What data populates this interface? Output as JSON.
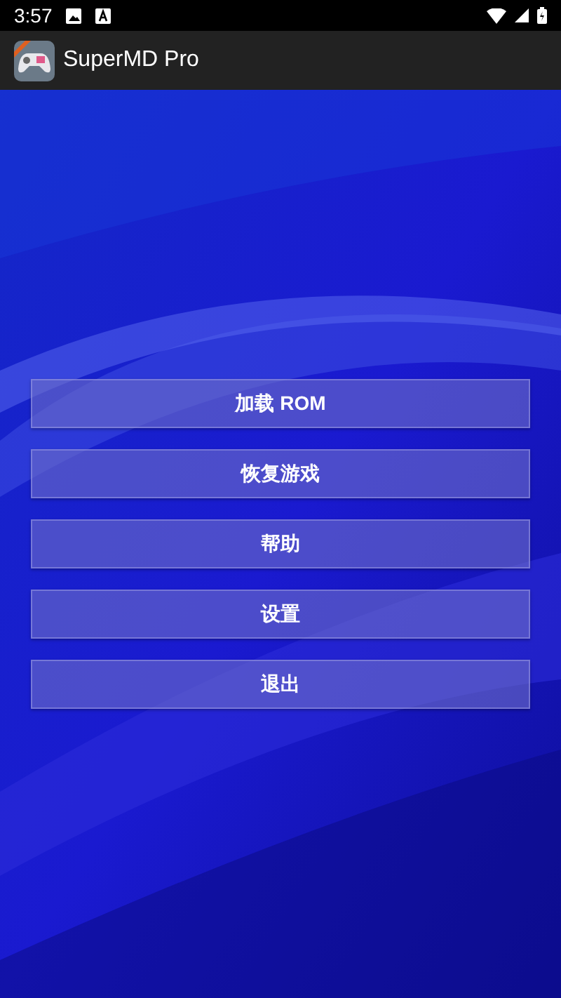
{
  "status_bar": {
    "time": "3:57"
  },
  "app_bar": {
    "title": "SuperMD Pro"
  },
  "menu": [
    {
      "label": "加载 ROM"
    },
    {
      "label": "恢复游戏"
    },
    {
      "label": "帮助"
    },
    {
      "label": "设置"
    },
    {
      "label": "退出"
    }
  ]
}
